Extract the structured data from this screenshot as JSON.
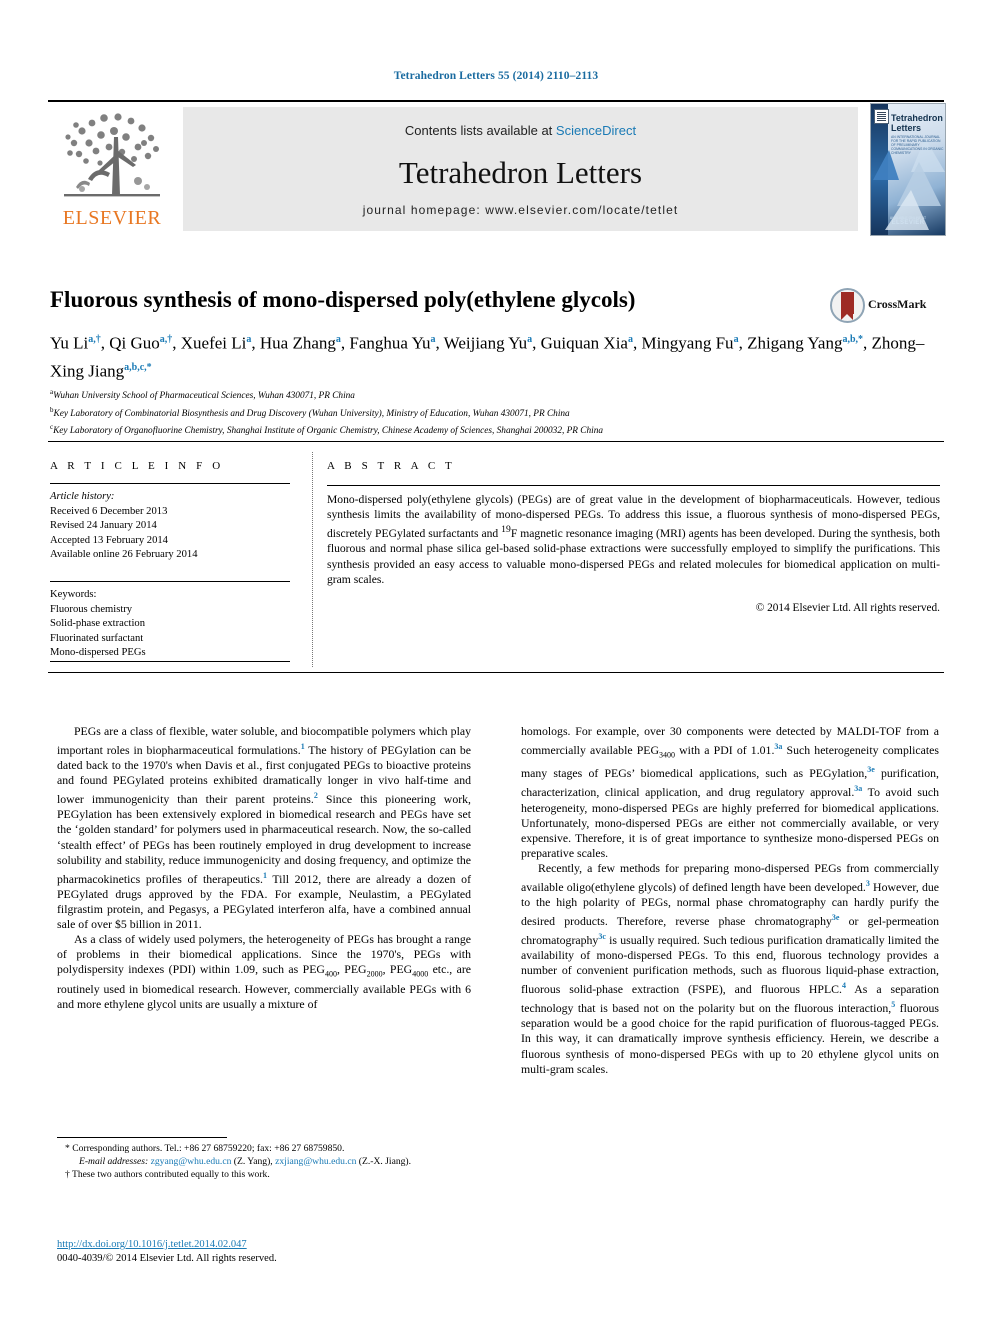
{
  "running_head": "Tetrahedron Letters 55 (2014) 2110–2113",
  "masthead": {
    "publisher": "ELSEVIER",
    "contents_prefix": "Contents lists available at ",
    "contents_link": "ScienceDirect",
    "journal_title": "Tetrahedron Letters",
    "homepage": "journal homepage: www.elsevier.com/locate/tetlet",
    "cover": {
      "title": "Tetrahedron Letters",
      "subtitle": "AN INTERNATIONAL JOURNAL FOR THE RAPID PUBLICATION OF PRELIMINARY COMMUNICATIONS IN ORGANIC CHEMISTRY",
      "footer_small": "AVAILABLE ONLINE AT",
      "footer_brand": "ELSEVIER"
    }
  },
  "article": {
    "title": "Fluorous synthesis of mono-dispersed poly(ethylene glycols)",
    "crossmark_label": "CrossMark",
    "authors_html": "Yu Li<sup>a,†</sup>, Qi Guo<sup>a,†</sup>, Xuefei Li<sup>a</sup>, Hua Zhang<sup>a</sup>, Fanghua Yu<sup>a</sup>, Weijiang Yu<sup>a</sup>, Guiquan Xia<sup>a</sup>, Mingyang Fu<sup>a</sup>, Zhigang Yang<sup>a,b,*</sup>, Zhong–Xing Jiang<sup>a,b,c,*</sup>",
    "affiliations": [
      {
        "marker": "a",
        "text": "Wuhan University School of Pharmaceutical Sciences, Wuhan 430071, PR China"
      },
      {
        "marker": "b",
        "text": "Key Laboratory of Combinatorial Biosynthesis and Drug Discovery (Wuhan University), Ministry of Education, Wuhan 430071, PR China"
      },
      {
        "marker": "c",
        "text": "Key Laboratory of Organofluorine Chemistry, Shanghai Institute of Organic Chemistry, Chinese Academy of Sciences, Shanghai 200032, PR China"
      }
    ]
  },
  "article_info": {
    "heading": "A R T I C L E   I N F O",
    "history_label": "Article history:",
    "history": [
      "Received 6 December 2013",
      "Revised 24 January 2014",
      "Accepted 13 February 2014",
      "Available online 26 February 2014"
    ],
    "keywords_label": "Keywords:",
    "keywords": [
      "Fluorous chemistry",
      "Solid-phase extraction",
      "Fluorinated surfactant",
      "Mono-dispersed PEGs"
    ]
  },
  "abstract": {
    "heading": "A B S T R A C T",
    "text_html": "Mono-dispersed poly(ethylene glycols) (PEGs) are of great value in the development of biopharmaceuticals. However, tedious synthesis limits the availability of mono-dispersed PEGs. To address this issue, a fluorous synthesis of mono-dispersed PEGs, discretely PEGylated surfactants and <sup style=\"color:#000;font-weight:normal\">19</sup>F magnetic resonance imaging (MRI) agents has been developed. During the synthesis, both fluorous and normal phase silica gel-based solid-phase extractions were successfully employed to simplify the purifications. This synthesis provided an easy access to valuable mono-dispersed PEGs and related molecules for biomedical application on multi-gram scales.",
    "copyright": "© 2014 Elsevier Ltd. All rights reserved."
  },
  "body": {
    "left_column_html": "<p class=\"first\">PEGs are a class of flexible, water soluble, and biocompatible polymers which play important roles in biopharmaceutical formulations.<sup>1</sup> The history of PEGylation can be dated back to the 1970's when Davis et al., first conjugated PEGs to bioactive proteins and found PEGylated proteins exhibited dramatically longer in vivo half-time and lower immunogenicity than their parent proteins.<sup>2</sup> Since this pioneering work, PEGylation has been extensively explored in biomedical research and PEGs have set the ‘golden standard’ for polymers used in pharmaceutical research. Now, the so-called ‘stealth effect’ of PEGs has been routinely employed in drug development to increase solubility and stability, reduce immunogenicity and dosing frequency, and optimize the pharmacokinetics profiles of therapeutics.<sup>1</sup> Till 2012, there are already a dozen of PEGylated drugs approved by the FDA. For example, Neulastim, a PEGylated filgrastim protein, and Pegasys, a PEGylated interferon alfa, have a combined annual sale of over $5 billion in 2011.</p><p>As a class of widely used polymers, the heterogeneity of PEGs has brought a range of problems in their biomedical applications. Since the 1970's, PEGs with polydispersity indexes (PDI) within 1.09, such as PEG<sub>400</sub>, PEG<sub>2000</sub>, PEG<sub>4000</sub> etc., are routinely used in biomedical research. However, commercially available PEGs with 6 and more ethylene glycol units are usually a mixture of</p>",
    "right_column_html": "<p style=\"text-indent:0\">homologs. For example, over 30 components were detected by MALDI-TOF from a commercially available PEG<sub>3400</sub> with a PDI of 1.01.<sup>3a</sup> Such heterogeneity complicates many stages of PEGs’ biomedical applications, such as PEGylation,<sup>3e</sup> purification, characterization, clinical application, and drug regulatory approval.<sup>3a</sup> To avoid such heterogeneity, mono-dispersed PEGs are highly preferred for biomedical applications. Unfortunately, mono-dispersed PEGs are either not commercially available, or very expensive. Therefore, it is of great importance to synthesize mono-dispersed PEGs on preparative scales.</p><p>Recently, a few methods for preparing mono-dispersed PEGs from commercially available oligo(ethylene glycols) of defined length have been developed.<sup>3</sup> However, due to the high polarity of PEGs, normal phase chromatography can hardly purify the desired products. Therefore, reverse phase chromatography<sup>3e</sup> or gel-permeation chromatography<sup>3c</sup> is usually required. Such tedious purification dramatically limited the availability of mono-dispersed PEGs. To this end, fluorous technology provides a number of convenient purification methods, such as fluorous liquid-phase extraction, fluorous solid-phase extraction (FSPE), and fluorous HPLC.<sup>4</sup> As a separation technology that is based not on the polarity but on the fluorous interaction,<sup>5</sup> fluorous separation would be a good choice for the rapid purification of fluorous-tagged PEGs. In this way, it can dramatically improve synthesis efficiency. Herein, we describe a fluorous synthesis of mono-dispersed PEGs with up to 20 ethylene glycol units on multi-gram scales.</p>"
  },
  "footnotes": {
    "corresponding_html": "* Corresponding authors. Tel.: +86 27 68759220; fax: +86 27 68759850.",
    "email_html": "<em>E-mail addresses:</em> <span class=\"lk\">zgyang@whu.edu.cn</span> (Z. Yang), <span class=\"lk\">zxjiang@whu.edu.cn</span> (Z.-X. Jiang).",
    "equal_contrib_html": "† These two authors contributed equally to this work.",
    "doi": "http://dx.doi.org/10.1016/j.tetlet.2014.02.047",
    "issn_line": "0040-4039/© 2014 Elsevier Ltd. All rights reserved."
  }
}
